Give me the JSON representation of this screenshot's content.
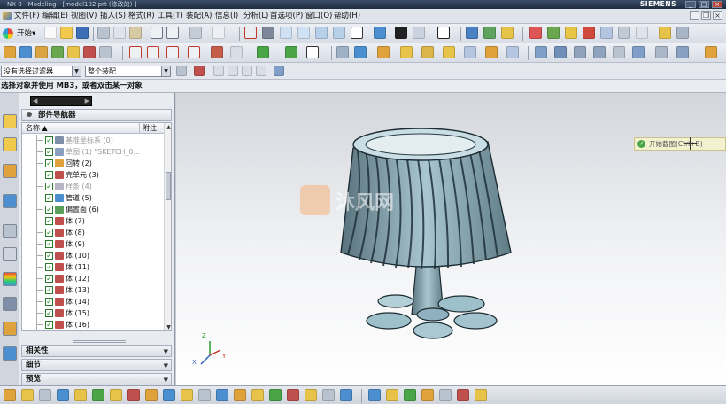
{
  "window": {
    "title": "NX 8 - Modeling - [model102.prt (修改的) ]",
    "brand": "SIEMENS",
    "controls": [
      "_",
      "□",
      "×"
    ]
  },
  "menu": {
    "items": [
      "文件(F)",
      "编辑(E)",
      "视图(V)",
      "插入(S)",
      "格式(R)",
      "工具(T)",
      "装配(A)",
      "信息(I)",
      "分析(L)",
      "首选项(P)",
      "窗口(O)",
      "帮助(H)"
    ],
    "mdi_controls": [
      "_",
      "❐",
      "×"
    ]
  },
  "toolbar": {
    "start_label": "开始▾"
  },
  "filter": {
    "type_filter": "没有选择过滤器",
    "assembly_scope": "整个装配"
  },
  "cue": {
    "prompt": "选择对象并使用 MB3，或者双击某一对象",
    "status": ""
  },
  "navigator": {
    "title": "部件导航器",
    "col_name": "名称",
    "col_note": "附注",
    "rows": [
      {
        "label": "基准坐标系 (0)",
        "icon_color": "#7f8fa8",
        "dim": true
      },
      {
        "label": "草图 (1) \"SKETCH_0...",
        "icon_color": "#8aa0c2",
        "dim": true
      },
      {
        "label": "回转 (2)",
        "icon_color": "#e0a23c",
        "dim": false
      },
      {
        "label": "壳单元 (3)",
        "icon_color": "#c0504d",
        "dim": false
      },
      {
        "label": "样条 (4)",
        "icon_color": "#b5b5c5",
        "dim": true
      },
      {
        "label": "管道 (5)",
        "icon_color": "#4c8fd1",
        "dim": false
      },
      {
        "label": "偏置面 (6)",
        "icon_color": "#5aa05a",
        "dim": false
      },
      {
        "label": "体 (7)",
        "icon_color": "#c0504d",
        "dim": false
      },
      {
        "label": "体 (8)",
        "icon_color": "#c0504d",
        "dim": false
      },
      {
        "label": "体 (9)",
        "icon_color": "#c0504d",
        "dim": false
      },
      {
        "label": "体 (10)",
        "icon_color": "#c0504d",
        "dim": false
      },
      {
        "label": "体 (11)",
        "icon_color": "#c0504d",
        "dim": false
      },
      {
        "label": "体 (12)",
        "icon_color": "#c0504d",
        "dim": false
      },
      {
        "label": "体 (13)",
        "icon_color": "#c0504d",
        "dim": false
      },
      {
        "label": "体 (14)",
        "icon_color": "#c0504d",
        "dim": false
      },
      {
        "label": "体 (15)",
        "icon_color": "#c0504d",
        "dim": false
      },
      {
        "label": "体 (16)",
        "icon_color": "#c0504d",
        "dim": false
      }
    ],
    "panels": [
      "相关性",
      "细节",
      "预览"
    ]
  },
  "viewport": {
    "tooltip": "开始截图(Ctrl+B)",
    "watermark_text": "沐风网",
    "triad_labels": [
      "Z",
      "Y",
      "X"
    ],
    "model_color": "#8fb1bf"
  }
}
